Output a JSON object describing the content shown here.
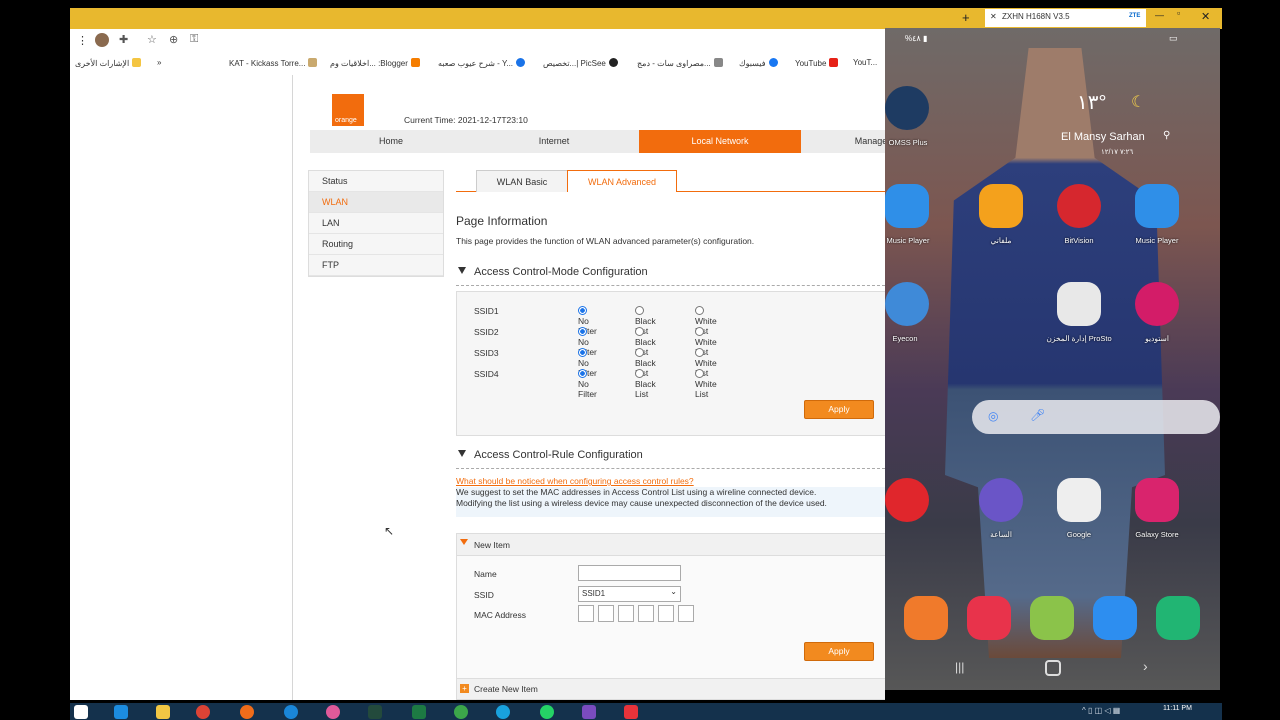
{
  "browser": {
    "tab_title": "ZXHN H168N V3.5",
    "new_tab_icon": "plus-icon",
    "bookmarks": [
      {
        "label": "YouT...",
        "color": "#e62117"
      },
      {
        "label": "YouTube",
        "color": "#e62117"
      },
      {
        "label": "فيسبوك",
        "color": "#1877f2"
      },
      {
        "label": "مصراوى سات - دمج...",
        "color": "#888888"
      },
      {
        "label": "تخصيص...| PicSee",
        "color": "#222222"
      },
      {
        "label": "شرح عيوب صعبه - Y...",
        "color": "#1a73e8"
      },
      {
        "label": "اخلاقيات وم... :Blogger",
        "color": "#f57d00"
      },
      {
        "label": "KAT - Kickass Torre...",
        "color": "#666666"
      }
    ],
    "overflow_label": "»",
    "other_bookmarks": "الإشارات الأخرى"
  },
  "router": {
    "logo": "orange",
    "current_time_label": "Current Time:",
    "current_time": "2021-12-17T23:10",
    "nav": [
      "Home",
      "Internet",
      "Local Network",
      "Management"
    ],
    "active_nav": "Local Network",
    "side_menu": [
      "Status",
      "WLAN",
      "LAN",
      "Routing",
      "FTP"
    ],
    "active_side": "WLAN",
    "sub_tabs": [
      "WLAN Basic",
      "WLAN Advanced"
    ],
    "active_sub_tab": "WLAN Advanced",
    "page_info_title": "Page Information",
    "page_info_text": "This page provides the function of WLAN advanced parameter(s) configuration.",
    "acm_title": "Access Control-Mode Configuration",
    "acm_options": [
      "No Filter",
      "Black List",
      "White List"
    ],
    "acm_rows": [
      {
        "ssid": "SSID1",
        "selected": "No Filter"
      },
      {
        "ssid": "SSID2",
        "selected": "No Filter"
      },
      {
        "ssid": "SSID3",
        "selected": "No Filter"
      },
      {
        "ssid": "SSID4",
        "selected": "No Filter"
      }
    ],
    "apply_label": "Apply",
    "acr_title": "Access Control-Rule Configuration",
    "acr_link": "What should be noticed when configuring access control rules?",
    "acr_note1": "We suggest to set the MAC addresses in Access Control List using a wireline connected device.",
    "acr_note2": "Modifying the list using a wireless device may cause unexpected disconnection of the device used.",
    "new_item_label": "New Item",
    "name_label": "Name",
    "name_value": "",
    "ssid_label": "SSID",
    "ssid_value": "SSID1",
    "mac_label": "MAC Address",
    "create_new_item": "Create New Item"
  },
  "phone": {
    "status_left": "%٤٨ ▮",
    "temperature": "١٣°",
    "location": "El Mansy Sarhan",
    "date": "٧:٢٦ ١٢/١٧",
    "apps_row0": [
      {
        "label": "OMSS Plus",
        "color": "#1e3b62"
      }
    ],
    "apps_row1": [
      {
        "label": "Music Player",
        "color": "#2f8fe8"
      },
      {
        "label": "ملفاتي",
        "color": "#f4a11c"
      },
      {
        "label": "BitVision",
        "color": "#d6272e"
      },
      {
        "label": "Music Player",
        "color": "#2f8fe8"
      }
    ],
    "apps_row2": [
      {
        "label": "Eyecon",
        "color": "#3f8ad8"
      },
      {
        "label": "إدارة المخزن ProSto",
        "color": "#e8e8e8"
      },
      {
        "label": "استوديو",
        "color": "#d31c68"
      }
    ],
    "apps_row3": [
      {
        "label": "",
        "color": "#e0262c"
      },
      {
        "label": "الساعة",
        "color": "#6a55c7"
      },
      {
        "label": "Google",
        "color": "#eeeeee"
      },
      {
        "label": "Galaxy Store",
        "color": "#d9246d"
      }
    ],
    "dock": [
      {
        "color": "#f07a2b"
      },
      {
        "color": "#e8334b"
      },
      {
        "color": "#8bc34a"
      },
      {
        "color": "#2d8ef0"
      },
      {
        "color": "#21b573"
      }
    ]
  },
  "taskbar": {
    "time": "11:11 PM"
  }
}
